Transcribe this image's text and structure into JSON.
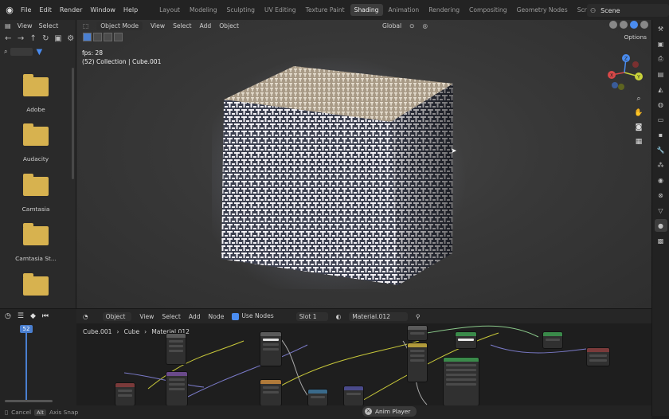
{
  "topbar": {
    "menu": [
      "File",
      "Edit",
      "Render",
      "Window",
      "Help"
    ],
    "tabs": [
      "Layout",
      "Modeling",
      "Sculpting",
      "UV Editing",
      "Texture Paint",
      "Shading",
      "Animation",
      "Rendering",
      "Compositing",
      "Geometry Nodes",
      "Scripting"
    ],
    "active_tab": "Shading",
    "add_tab": "+",
    "scene": "Scene"
  },
  "file_browser": {
    "menu": [
      "View",
      "Select"
    ],
    "folders": [
      "Adobe",
      "Audacity",
      "Camtasia",
      "Camtasia St...",
      ""
    ]
  },
  "viewport": {
    "mode": "Object Mode",
    "menu": [
      "View",
      "Select",
      "Add",
      "Object"
    ],
    "transform": "Global",
    "options": "Options",
    "fps": "fps: 28",
    "collection": "(52) Collection | Cube.001",
    "gizmo_axes": [
      "X",
      "Y",
      "Z"
    ]
  },
  "timeline": {
    "current_frame": "52"
  },
  "node_editor": {
    "type": "Object",
    "menu": [
      "View",
      "Select",
      "Add",
      "Node"
    ],
    "use_nodes": "Use Nodes",
    "slot": "Slot 1",
    "material": "Material.012",
    "breadcrumb": [
      "Cube.001",
      "Cube",
      "Material.012"
    ]
  },
  "statusbar": {
    "cancel": "Cancel",
    "alt_key": "Alt",
    "axis_snap": "Axis Snap",
    "anim_player": "Anim Player"
  },
  "colors": {
    "accent": "#4a8cf0",
    "folder": "#d7b24f",
    "background": "#1d1d1d"
  }
}
